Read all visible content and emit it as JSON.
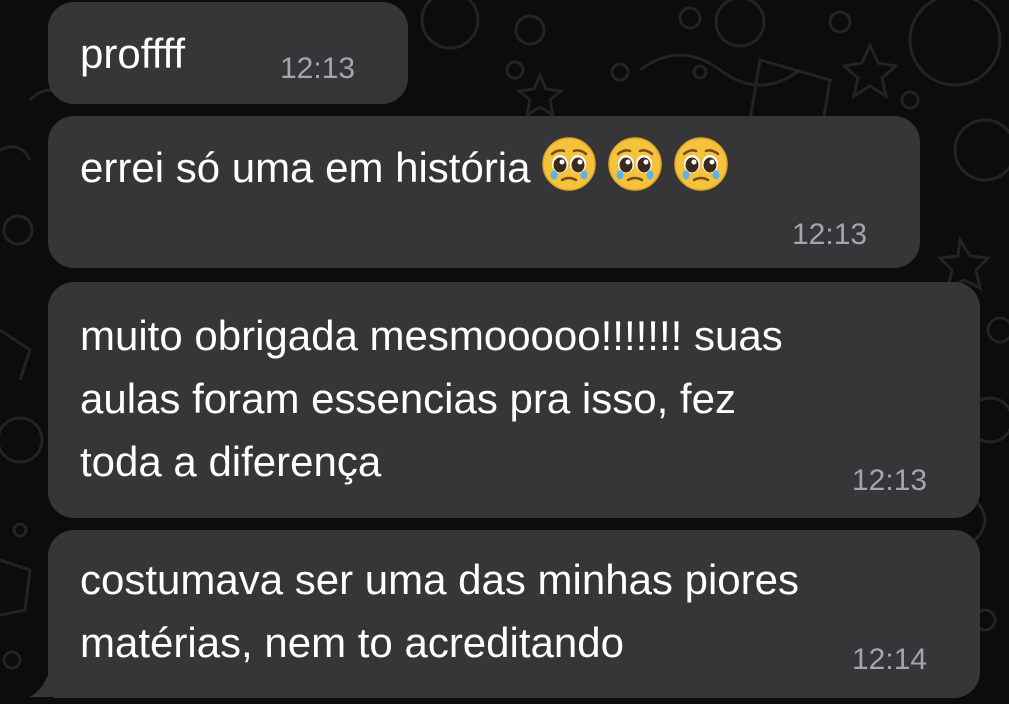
{
  "colors": {
    "background": "#0c0c0c",
    "bubble": "#363638",
    "text": "#ffffff",
    "timestamp": "#a5a5aa"
  },
  "messages": [
    {
      "lines": [
        "proffff"
      ],
      "time": "12:13"
    },
    {
      "lines": [
        "errei só uma em história"
      ],
      "emojis": [
        "pleading-face-icon",
        "pleading-face-icon",
        "pleading-face-icon"
      ],
      "time": "12:13"
    },
    {
      "lines": [
        "muito obrigada mesmooooo!!!!!!! suas",
        "aulas foram essencias pra isso, fez",
        "toda a diferença"
      ],
      "time": "12:13"
    },
    {
      "lines": [
        "costumava ser uma das minhas piores",
        "matérias, nem to acreditando"
      ],
      "time": "12:14"
    }
  ]
}
